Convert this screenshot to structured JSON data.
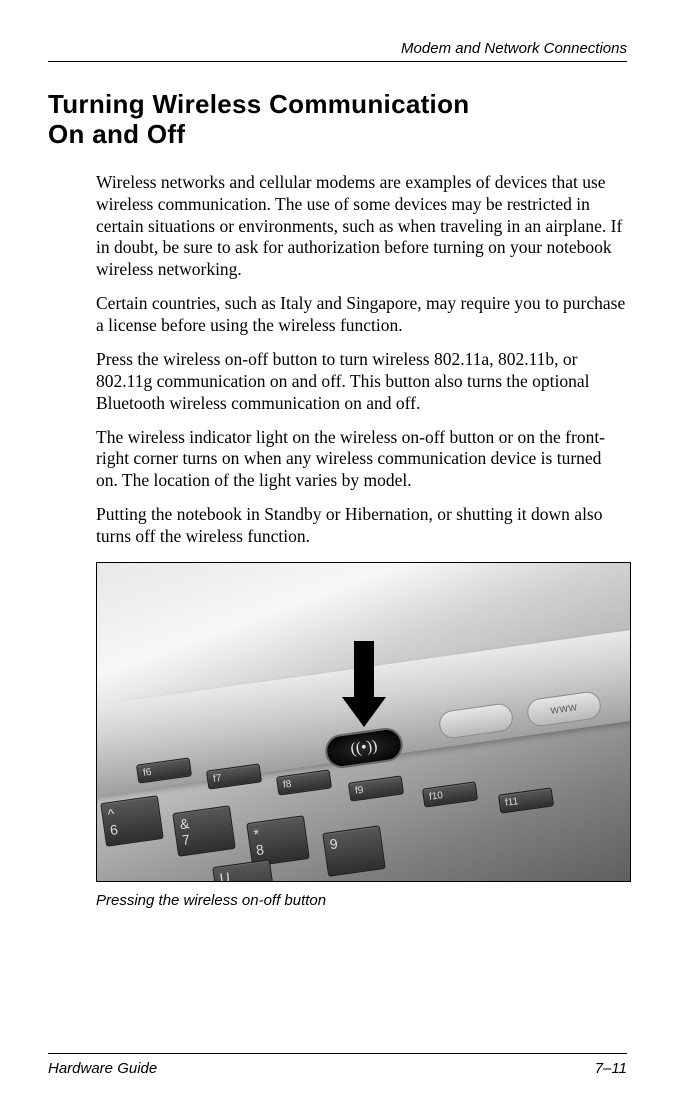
{
  "header": {
    "chapter": "Modem and Network Connections"
  },
  "heading": {
    "line1": "Turning Wireless Communication",
    "line2": "On and Off"
  },
  "paragraphs": {
    "p1": "Wireless networks and cellular modems are examples of devices that use wireless communication. The use of some devices may be restricted in certain situations or environments, such as when traveling in an airplane. If in doubt, be sure to ask for authorization before turning on your notebook wireless networking.",
    "p2": "Certain countries, such as Italy and Singapore, may require you to purchase a license before using the wireless function.",
    "p3": "Press the wireless on-off button to turn wireless 802.11a, 802.11b, or 802.11g communication on and off. This button also turns the optional Bluetooth wireless communication on and off.",
    "p4": "The wireless indicator light on the wireless on-off button or on the front-right corner turns on when any wireless communication device is turned on. The location of the light varies by model.",
    "p5": "Putting the notebook in Standby or Hibernation, or shutting it down also turns off the wireless function."
  },
  "figure": {
    "caption": "Pressing the wireless on-off button",
    "button_glyph": "((•))",
    "pill_right_label": "WWW",
    "keys": {
      "f6": "f6",
      "f7": "f7",
      "f8": "f8",
      "f9": "f9",
      "f10": "f10",
      "f11": "f11",
      "caret": "^",
      "amp": "&",
      "star": "*",
      "n6": "6",
      "n7": "7",
      "n8": "8",
      "n9": "9",
      "u": "U"
    }
  },
  "footer": {
    "doc_title": "Hardware Guide",
    "page_num": "7–11"
  }
}
